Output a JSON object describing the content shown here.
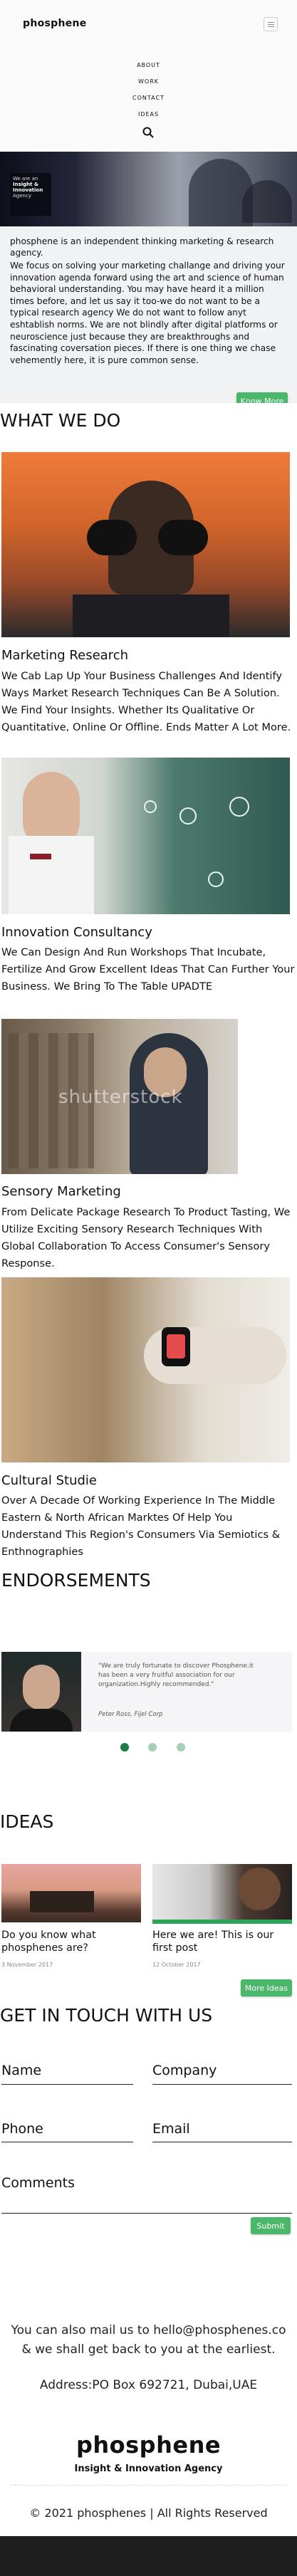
{
  "brand": {
    "name": "phosphene",
    "tagline": "Insight & Innovation Agency"
  },
  "nav": {
    "items": [
      "ABOUT",
      "WORK",
      "CONTACT",
      "IDEAS"
    ],
    "search_icon": "search-icon",
    "menu_icon": "hamburger-icon"
  },
  "hero": {
    "badge_lines": [
      "We are an",
      "Insight &",
      "Innovation",
      "Agency"
    ],
    "intro": "phosphene is an independent thinking marketing & research agency.",
    "body": "We focus on solving your marketing challange and driving your innovation agenda forward using the art and science of human behavioral understanding. You may have heard it a million times before, and let us say it too-we do not want to be a typical research agency We do not want to follow anyt eshtablish norms. We are not blindly after digital platforms or neuroscience just because they are breakthroughs and fascinating coversation pieces. If there is one thing we chase vehemently here, it is pure common sense.",
    "cta": "Know More"
  },
  "what_we_do": {
    "title": "WHAT WE DO",
    "cards": [
      {
        "title": "Marketing Research",
        "text": "We Cab Lap Up Your Business Challenges And Identify Ways Market Research Techniques Can Be A Solution. We Find Your Insights. Whether Its Qualitative Or Quantitative, Online Or Offline. Ends Matter A Lot More."
      },
      {
        "title": "Innovation Consultancy",
        "text": "We Can Design And Run Workshops That Incubate, Fertilize And Grow Excellent Ideas That Can Further Your Business. We Bring To The Table UPADTE"
      },
      {
        "title": "Sensory Marketing",
        "text": "From Delicate Package Research To Product Tasting, We Utilize Exciting Sensory Research Techniques With Global Collaboration To Access Consumer's Sensory Response.",
        "watermark": "shutterstock"
      },
      {
        "title": "Cultural Studie",
        "text": "Over A Decade Of Working Experience In The Middle Eastern & North African Marktes Of Help You Understand This Region's Consumers Via Semiotics & Enthnographies"
      }
    ]
  },
  "endorsements": {
    "title": "ENDORSEMENTS",
    "quote": "\"We are truly fortunate to discover Phosphene.it has been a very fruitful association for our organization.Highly recommended.\"",
    "author": "Peter Ross, Fijel Corp"
  },
  "ideas": {
    "title": "IDEAS",
    "posts": [
      {
        "title": "Do you know what phosphenes are?",
        "date": "3 November 2017"
      },
      {
        "title": "Here we are! This is our first post",
        "date": "12 October 2017"
      }
    ],
    "cta": "More Ideas"
  },
  "contact": {
    "title": "GET IN TOUCH WITH US",
    "fields": {
      "name": "Name",
      "company": "Company",
      "phone": "Phone",
      "email": "Email",
      "comments": "Comments"
    },
    "submit": "Submit",
    "mail_text": "You can also mail us to hello@phosphenes.co & we shall get back to you at the earliest.",
    "address": "Address:PO Box 692721, Dubai,UAE"
  },
  "footer": {
    "copyright": "© 2021 phosphenes | All Rights Reserved"
  },
  "colors": {
    "accent": "#4bb76a",
    "dark": "#1e1e1e",
    "light_bg": "#f5f6f7"
  }
}
